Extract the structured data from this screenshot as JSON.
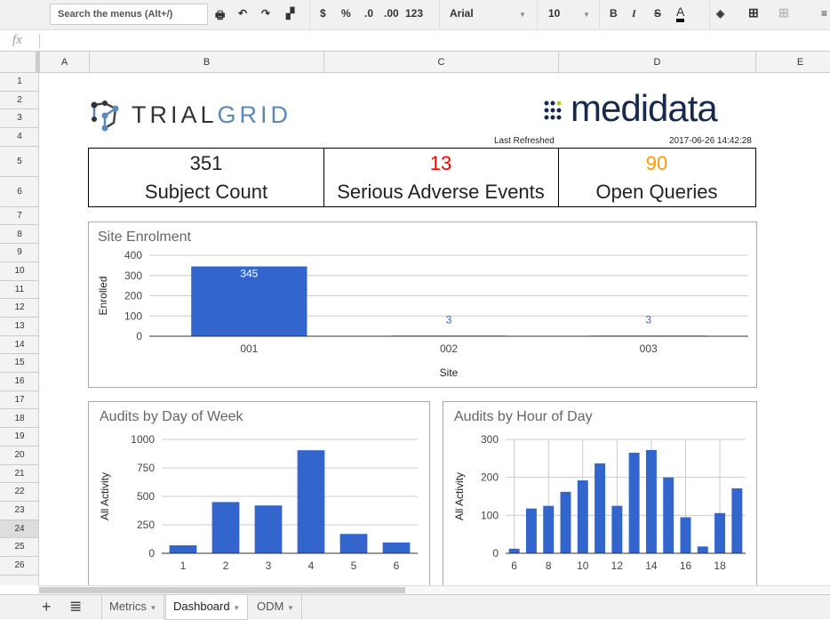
{
  "toolbar": {
    "search_placeholder": "Search the menus (Alt+/)",
    "currency": "$",
    "percent": "%",
    "dec_less": ".0",
    "dec_more": ".00",
    "format_more": "123",
    "font": "Arial",
    "size": "10",
    "bold": "B",
    "italic": "I",
    "strike": "S",
    "text_color": "A"
  },
  "formula_bar": {
    "icon": "fx",
    "value": ""
  },
  "columns": [
    "A",
    "B",
    "C",
    "D",
    "E"
  ],
  "rows": [
    "1",
    "2",
    "3",
    "4",
    "5",
    "6",
    "7",
    "8",
    "9",
    "10",
    "11",
    "12",
    "13",
    "14",
    "15",
    "16",
    "17",
    "18",
    "19",
    "20",
    "21",
    "22",
    "23",
    "24",
    "25",
    "26"
  ],
  "header": {
    "logo_left": "TRIALGRID",
    "logo_right": "medidata",
    "last_refreshed_label": "Last Refreshed",
    "last_refreshed_value": "2017-06-26 14:42:28"
  },
  "kpis": [
    {
      "value": "351",
      "label": "Subject Count",
      "color": "#000000"
    },
    {
      "value": "13",
      "label": "Serious Adverse Events",
      "color": "#ff0000"
    },
    {
      "value": "90",
      "label": "Open Queries",
      "color": "#ff9900"
    }
  ],
  "chart_data": [
    {
      "type": "bar",
      "title": "Site Enrolment",
      "xlabel": "Site",
      "ylabel": "Enrolled",
      "categories": [
        "001",
        "002",
        "003"
      ],
      "values": [
        345,
        3,
        3
      ],
      "ylim": [
        0,
        400
      ],
      "yticks": [
        "0",
        "100",
        "200",
        "300",
        "400"
      ],
      "data_labels": [
        "345",
        "3",
        "3"
      ],
      "grid": true,
      "color": "#3366cc"
    },
    {
      "type": "bar",
      "title": "Audits by Day of Week",
      "xlabel": "",
      "ylabel": "All Activity",
      "categories": [
        "1",
        "2",
        "3",
        "4",
        "5",
        "6"
      ],
      "values": [
        70,
        450,
        420,
        905,
        170,
        95
      ],
      "ylim": [
        0,
        1000
      ],
      "yticks": [
        "0",
        "250",
        "500",
        "750",
        "1000"
      ],
      "grid": true,
      "color": "#3366cc"
    },
    {
      "type": "bar",
      "title": "Audits by Hour of Day",
      "xlabel": "",
      "ylabel": "All Activity",
      "categories": [
        "6",
        "7",
        "8",
        "9",
        "10",
        "11",
        "12",
        "13",
        "14",
        "15",
        "16",
        "17",
        "18",
        "19"
      ],
      "values": [
        12,
        118,
        125,
        162,
        192,
        237,
        125,
        265,
        272,
        200,
        95,
        18,
        106,
        171
      ],
      "xticks": [
        "6",
        "8",
        "10",
        "12",
        "14",
        "16",
        "18"
      ],
      "ylim": [
        0,
        300
      ],
      "yticks": [
        "0",
        "100",
        "200",
        "300"
      ],
      "grid": true,
      "color": "#3366cc"
    }
  ],
  "sheets": [
    {
      "label": "Metrics"
    },
    {
      "label": "Dashboard",
      "active": true
    },
    {
      "label": "ODM"
    }
  ],
  "selected_row": "24"
}
